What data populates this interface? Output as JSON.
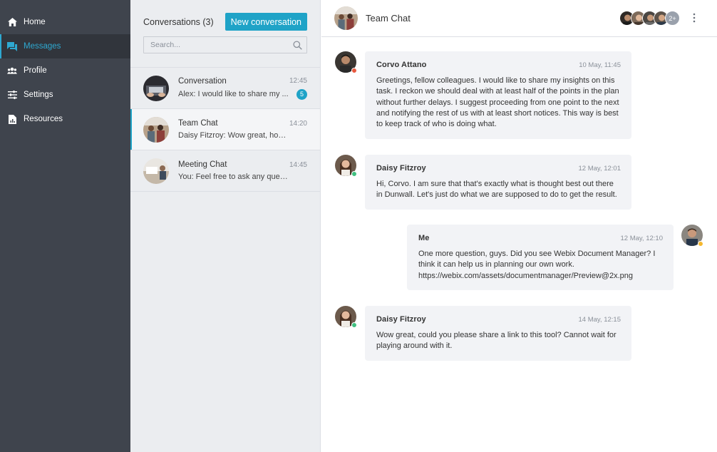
{
  "sidebar": {
    "items": [
      {
        "label": "Home",
        "icon": "home-icon"
      },
      {
        "label": "Messages",
        "icon": "messages-icon"
      },
      {
        "label": "Profile",
        "icon": "profile-icon"
      },
      {
        "label": "Settings",
        "icon": "settings-icon"
      },
      {
        "label": "Resources",
        "icon": "resources-icon"
      }
    ],
    "active": "Messages"
  },
  "conversations": {
    "title": "Conversations (3)",
    "new_button": "New conversation",
    "search_placeholder": "Search...",
    "items": [
      {
        "name": "Conversation",
        "time": "12:45",
        "preview": "Alex: I would like to share my ...",
        "badge": "5"
      },
      {
        "name": "Team Chat",
        "time": "14:20",
        "preview": "Daisy Fitzroy: Wow great, how...",
        "badge": ""
      },
      {
        "name": "Meeting Chat",
        "time": "14:45",
        "preview": "You: Feel free to ask any ques...",
        "badge": ""
      }
    ]
  },
  "chat": {
    "title": "Team Chat",
    "members_more": "2+",
    "messages": [
      {
        "author": "Corvo Attano",
        "date": "10 May, 11:45",
        "text": "Greetings, fellow colleagues. I would like to share my insights on this task. I reckon we should deal with at least half of the points in the plan without further delays. I suggest proceeding from one point to the next and notifying the rest of us with at least short notices. This way is best to keep track of who is doing what.",
        "status": "#e8593f"
      },
      {
        "author": "Daisy Fitzroy",
        "date": "12 May, 12:01",
        "text": "Hi, Corvo. I am sure that that's exactly what is thought best out there in Dunwall. Let's just do what we are supposed to do to get the result.",
        "status": "#3fbf7f"
      },
      {
        "author": "Me",
        "date": "12 May, 12:10",
        "text": "One more question, guys. Did you see Webix Document Manager? I think it can help us in planning our own work. https://webix.com/assets/documentmanager/Preview@2x.png",
        "status": "#f5b82e"
      },
      {
        "author": "Daisy Fitzroy",
        "date": "14 May, 12:15",
        "text": "Wow great, could you please share a link to this tool? Cannot wait for playing around with it.",
        "status": "#3fbf7f"
      }
    ]
  },
  "colors": {
    "accent": "#1fa3c7",
    "sidebar_bg": "#3f444d",
    "list_bg": "#ebedf0",
    "bubble_bg": "#f2f3f6"
  }
}
